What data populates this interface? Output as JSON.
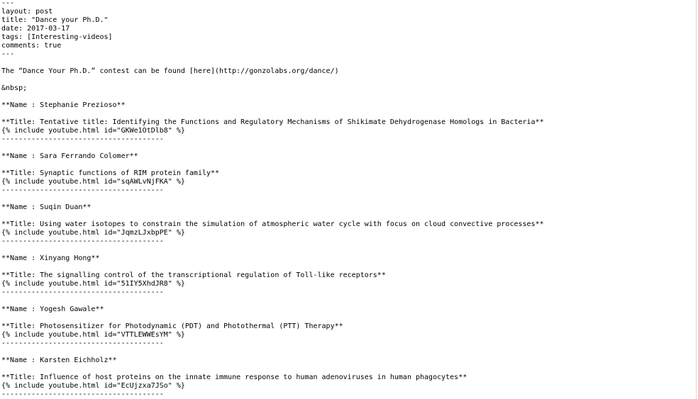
{
  "document": {
    "lines": [
      "---",
      "layout: post",
      "title: \"Dance your Ph.D.\"",
      "date: 2017-03-17",
      "tags: [Interesting-videos]",
      "comments: true",
      "---",
      "",
      "The “Dance Your Ph.D.” contest can be found [here](http://gonzolabs.org/dance/)",
      "",
      "&nbsp;",
      "",
      "**Name : Stephanie Prezioso**",
      "",
      "**Title: Tentative title: Identifying the Functions and Regulatory Mechanisms of Shikimate Dehydrogenase Homologs in Bacteria**",
      "{% include youtube.html id=\"GKWe1OtDlb8\" %}",
      "--------------------------------------",
      "",
      "**Name : Sara Ferrando Colomer**",
      "",
      "**Title: Synaptic functions of RIM protein family**",
      "{% include youtube.html id=\"sqAWLvNjFKA\" %}",
      "--------------------------------------",
      "",
      "**Name : Suqin Duan**",
      "",
      "**Title: Using water isotopes to constrain the simulation of atmospheric water cycle with focus on cloud convective processes**",
      "{% include youtube.html id=\"JqmzLJxbpPE\" %}",
      "--------------------------------------",
      "",
      "**Name : Xinyang Hong**",
      "",
      "**Title: The signalling control of the transcriptional regulation of Toll-like receptors**",
      "{% include youtube.html id=\"51IY5XhdJR8\" %}",
      "--------------------------------------",
      "",
      "**Name : Yogesh Gawale**",
      "",
      "**Title: Photosensitizer for Photodynamic (PDT) and Photothermal (PTT) Therapy**",
      "{% include youtube.html id=\"VTTLEWWEsYM\" %}",
      "--------------------------------------",
      "",
      "**Name : Karsten Eichholz**",
      "",
      "**Title: Influence of host proteins on the innate immune response to human adenoviruses in human phagocytes**",
      "{% include youtube.html id=\"EcUjzxa7JSo\" %}",
      "--------------------------------------"
    ]
  }
}
